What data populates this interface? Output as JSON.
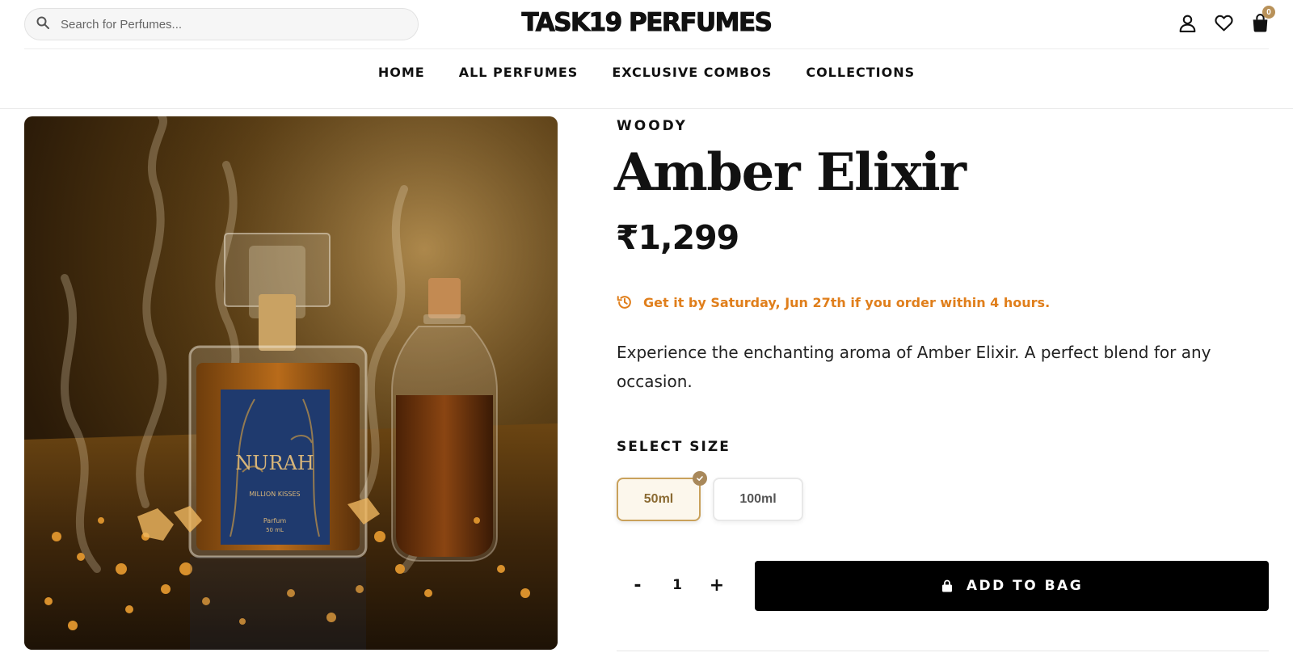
{
  "header": {
    "search_placeholder": "Search for Perfumes...",
    "logo": "TASK19 PERFUMES",
    "cart_count": "0"
  },
  "nav": {
    "items": [
      "HOME",
      "ALL PERFUMES",
      "EXCLUSIVE COMBOS",
      "COLLECTIONS"
    ]
  },
  "product": {
    "category": "WOODY",
    "name": "Amber Elixir",
    "price": "₹1,299",
    "delivery": {
      "prefix": "Get it by ",
      "date": "Saturday, Jun 27th",
      "suffix": " if you order within 4 hours."
    },
    "description": "Experience the enchanting aroma of Amber Elixir. A perfect blend for any occasion.",
    "image_label": {
      "brand": "NURAH",
      "line": "MILLION KISSES",
      "type": "Parfum",
      "volume": "50 mL"
    },
    "size_label": "SELECT SIZE",
    "sizes": [
      {
        "label": "50ml",
        "selected": true
      },
      {
        "label": "100ml",
        "selected": false
      }
    ],
    "quantity": "1",
    "qty_minus": "-",
    "qty_plus": "+",
    "add_to_bag": "ADD TO BAG"
  },
  "colors": {
    "accent_gold": "#c9a15b",
    "delivery_orange": "#e07f1c",
    "button_black": "#000000"
  },
  "icons": [
    "search-icon",
    "user-icon",
    "heart-icon",
    "bag-icon",
    "clock-history-icon",
    "check-icon",
    "lock-bag-icon"
  ]
}
